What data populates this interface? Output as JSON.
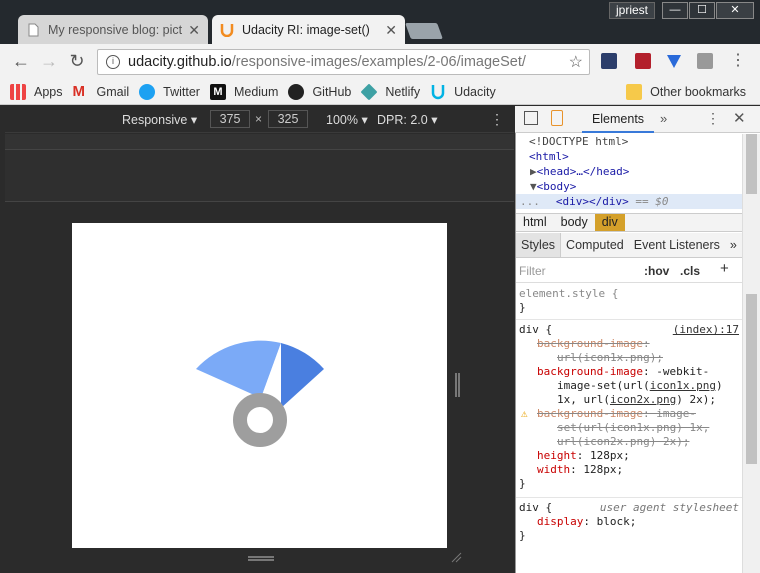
{
  "tabs": [
    {
      "title": "My responsive blog: pictu",
      "icon": "page-icon"
    },
    {
      "title": "Udacity RI: image-set()",
      "icon": "udacity-icon"
    }
  ],
  "user": "jpriest",
  "window_controls": {
    "minimize": "—",
    "maximize": "☐",
    "close": "✕"
  },
  "address": {
    "host": "udacity.github.io",
    "path": "/responsive-images/examples/2-06/imageSet/"
  },
  "bookmarks": [
    {
      "label": "Apps",
      "icon": "apps-grid-icon"
    },
    {
      "label": "Gmail",
      "icon": "gmail-icon"
    },
    {
      "label": "Twitter",
      "icon": "twitter-icon"
    },
    {
      "label": "Medium",
      "icon": "medium-icon"
    },
    {
      "label": "GitHub",
      "icon": "github-icon"
    },
    {
      "label": "Netlify",
      "icon": "netlify-icon"
    },
    {
      "label": "Udacity",
      "icon": "udacity-icon"
    }
  ],
  "other_bookmarks": "Other bookmarks",
  "device_toolbar": {
    "mode": "Responsive",
    "width": "375",
    "times": "×",
    "height": "325",
    "zoom": "100%",
    "dpr": "DPR: 2.0"
  },
  "devtools": {
    "active_panel": "Elements",
    "more": "»",
    "dom": {
      "doctype": "<!DOCTYPE html>",
      "html_open": "<html>",
      "head": "<head>…</head>",
      "body_open": "<body>",
      "selected": "<div></div>",
      "selected_marker": "== $0",
      "ellipsis": "..."
    },
    "breadcrumbs": [
      "html",
      "body",
      "div"
    ],
    "subtabs": [
      "Styles",
      "Computed",
      "Event Listeners"
    ],
    "subtabs_more": "»",
    "filter_placeholder": "Filter",
    "hov": ":hov",
    "cls": ".cls",
    "plus": "+",
    "styles": {
      "element_style": "element.style {",
      "close": "}",
      "rule_selector": "div {",
      "rule_source": "(index):17",
      "p1_name": "background-image",
      "p1_v1": "url(",
      "p1_link": "icon1x.png",
      "p1_v2": ");",
      "p2_name": "background-image",
      "p2_v1": ": -webkit-",
      "p2_l2a": "image-set(url(",
      "p2_link1": "icon1x.png",
      "p2_l2b": ")",
      "p2_l3a": "1x, url(",
      "p2_link2": "icon2x.png",
      "p2_l3b": ") 2x);",
      "p3_name": "background-image",
      "p3_v1": ": image-",
      "p3_l2a": "set(url(",
      "p3_link1": "icon1x.png",
      "p3_l2b": ") 1x,",
      "p3_l3a": "url(",
      "p3_link2": "icon2x.png",
      "p3_l3b": ") 2x);",
      "height_name": "height",
      "height_val": "128px;",
      "width_name": "width",
      "width_val": "128px;",
      "ua_selector": "div {",
      "ua_source": "user agent stylesheet",
      "display_name": "display",
      "display_val": "block;"
    }
  },
  "colors": {
    "chrome_dark": "#24292e",
    "logo_light_blue": "#7baaf7",
    "logo_blue": "#4a7fe0",
    "logo_gray": "#9e9e9e",
    "selected_crumb": "#d4a02a"
  }
}
